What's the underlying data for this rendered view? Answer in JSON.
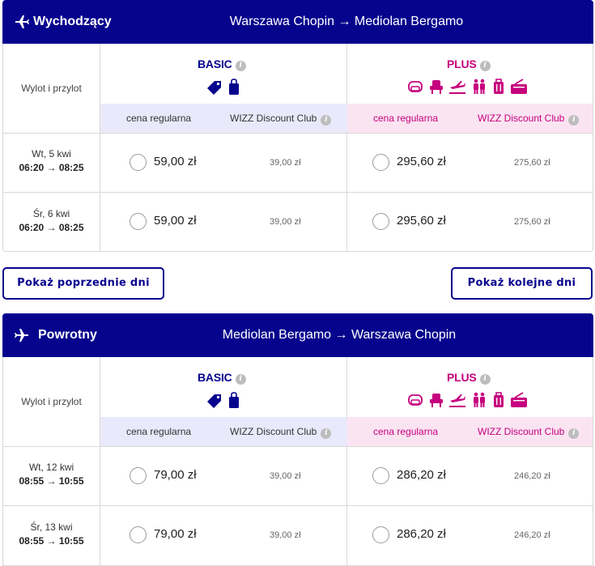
{
  "outbound": {
    "direction": "Wychodzący",
    "route": "Warszawa Chopin → Mediolan Bergamo",
    "column_label": "Wylot i przylot",
    "basic_title": "BASIC",
    "plus_title": "PLUS",
    "info_glyph": "i",
    "basic_regular_label": "cena regularna",
    "basic_club_label": "WIZZ Discount Club",
    "plus_regular_label": "cena regularna",
    "plus_club_label": "WIZZ Discount Club",
    "rows": [
      {
        "day": "Wt, 5 kwi",
        "time": "06:20 → 08:25",
        "basic_price": "59,00 zł",
        "basic_club": "39,00 zł",
        "plus_price": "295,60 zł",
        "plus_club": "275,60 zł"
      },
      {
        "day": "Śr, 6 kwi",
        "time": "06:20 → 08:25",
        "basic_price": "59,00 zł",
        "basic_club": "39,00 zł",
        "plus_price": "295,60 zł",
        "plus_club": "275,60 zł"
      }
    ]
  },
  "nav": {
    "prev_label": "Pokaż poprzednie dni",
    "next_label": "Pokaż kolejne dni"
  },
  "return": {
    "direction": "Powrotny",
    "route": "Mediolan Bergamo → Warszawa Chopin",
    "column_label": "Wylot i przylot",
    "basic_title": "BASIC",
    "plus_title": "PLUS",
    "info_glyph": "i",
    "basic_regular_label": "cena regularna",
    "basic_club_label": "WIZZ Discount Club",
    "plus_regular_label": "cena regularna",
    "plus_club_label": "WIZZ Discount Club",
    "rows": [
      {
        "day": "Wt, 12 kwi",
        "time": "08:55 → 10:55",
        "basic_price": "79,00 zł",
        "basic_club": "39,00 zł",
        "plus_price": "286,20 zł",
        "plus_club": "246,20 zł"
      },
      {
        "day": "Śr, 13 kwi",
        "time": "08:55 → 10:55",
        "basic_price": "79,00 zł",
        "basic_club": "39,00 zł",
        "plus_price": "286,20 zł",
        "plus_club": "246,20 zł"
      }
    ]
  },
  "icons": {
    "direction_outbound": "plane-takeoff-icon",
    "direction_return": "plane-landing-icon",
    "basic": [
      "luggage-tag-icon",
      "small-bag-icon"
    ],
    "plus": [
      "seat-icon",
      "reserved-seat-icon",
      "check-in-icon",
      "priority-boarding-icon",
      "trolley-bag-icon",
      "checked-bag-icon"
    ]
  },
  "colors": {
    "header_bg": "#06038d",
    "basic": "#06038d",
    "plus": "#c6007e",
    "basic_sub_bg": "#e9e9fb",
    "plus_sub_bg": "#fbe4f2"
  }
}
